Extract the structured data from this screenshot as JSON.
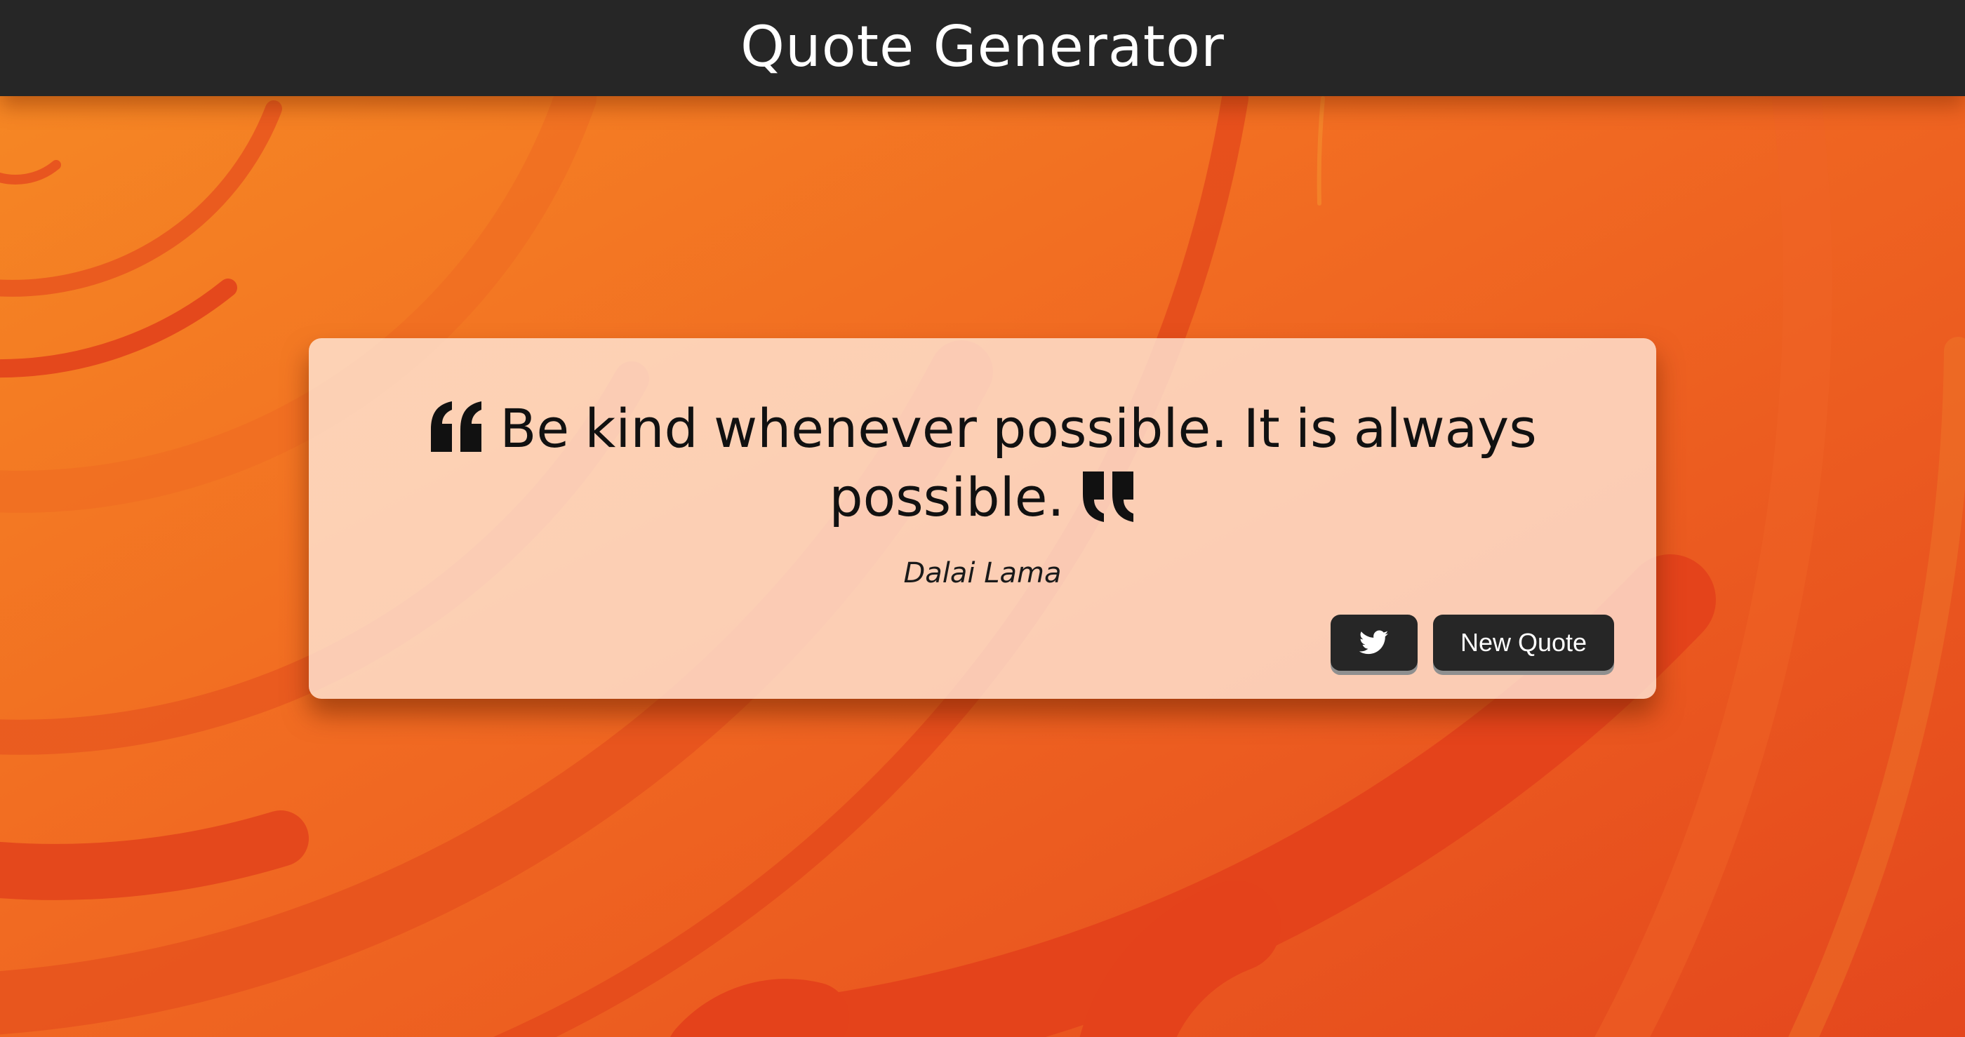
{
  "header": {
    "title": "Quote Generator"
  },
  "quote": {
    "text": "Be kind whenever possible. It is always possible.",
    "author": "Dalai Lama"
  },
  "actions": {
    "tweet_icon": "twitter-icon",
    "new_quote_label": "New Quote"
  },
  "colors": {
    "header_bg": "#262626",
    "background_orange": "#f07020",
    "background_deep": "#e44a1c",
    "card_bg": "#fde0cf",
    "button_bg": "#262626"
  }
}
